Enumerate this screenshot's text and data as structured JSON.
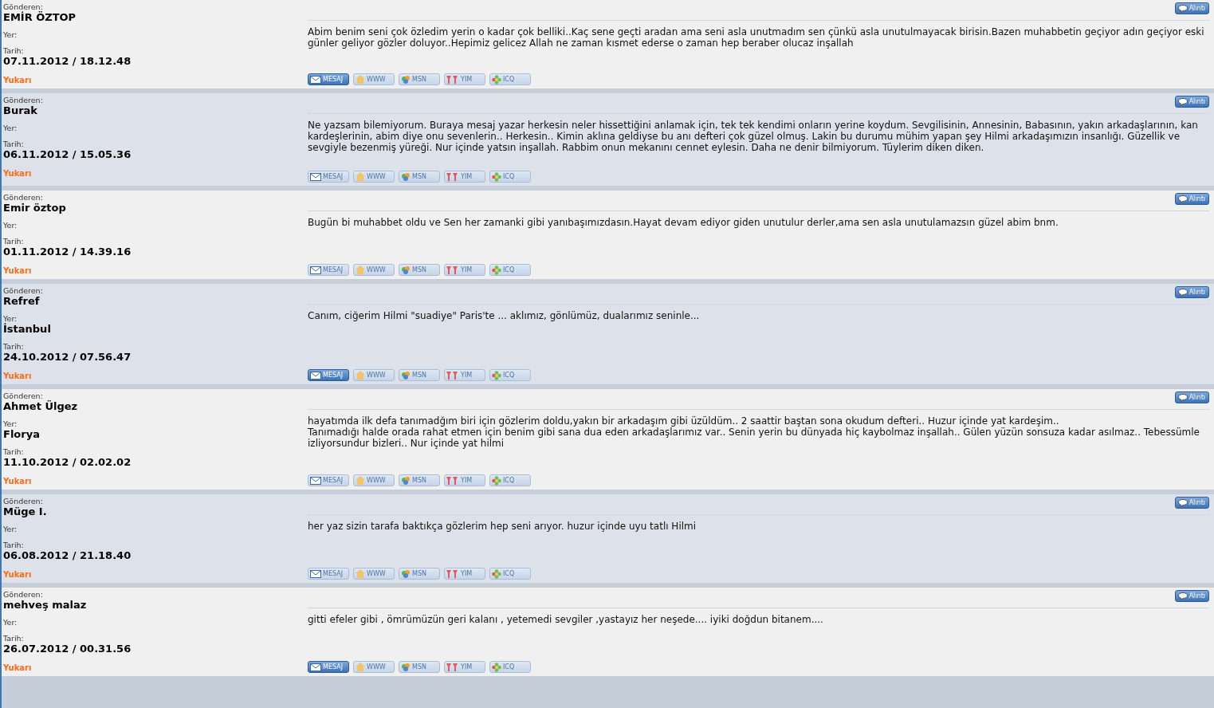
{
  "entries": [
    {
      "sender_label": "Gönderen:",
      "sender": "EMİR ÖZTOP",
      "location_label": "Yer:",
      "date_label": "Tarih:",
      "date": "07.11.2012 / 18.12.48",
      "top_link": "Yukarı",
      "quote_button": "Alıntı",
      "message": [
        "Abim benim seni çok özledim yerin o kadar çok belliki..Kaç sene geçti aradan ama seni asla unutmadım sen çünkü asla unutulmayacak birisin.Bazen muhabbetin geçiyor adın geçiyor eski günler geliyor gözler doluyor..Hepimiz gelicez Allah ne zaman kısmet ederse o zaman hep beraber olucaz inşallah"
      ],
      "buttons": [
        {
          "kind": "mail",
          "label": "MESAJ",
          "enabled": true
        },
        {
          "kind": "home",
          "label": "WWW",
          "enabled": false
        },
        {
          "kind": "msn",
          "label": "MSN",
          "enabled": false
        },
        {
          "kind": "yim",
          "label": "YIM",
          "enabled": false
        },
        {
          "kind": "icq",
          "label": "ICQ",
          "enabled": false
        }
      ]
    },
    {
      "sender_label": "Gönderen:",
      "sender": "Burak",
      "location_label": "Yer:",
      "date_label": "Tarih:",
      "date": "06.11.2012 / 15.05.36",
      "top_link": "Yukarı",
      "quote_button": "Alıntı",
      "message": [
        "Ne yazsam bilemiyorum. Buraya mesaj yazar herkesin neler hissettiğini anlamak için, tek tek kendimi onların yerine koydum. Sevgilisinin, Annesinin, Babasının, yakın arkadaşlarının, kan kardeşlerinin, abim diye onu sevenlerin.. Herkesin.. Kimin aklına geldiyse bu anı defteri çok güzel olmuş. Lakin bu durumu mühim yapan şey Hilmi arkadaşımızın insanlığı. Güzellik ve sevgiyle bezenmiş yüreği. Nur içinde yatsın inşallah. Rabbim onun mekanını cennet eylesin. Daha ne denir bilmiyorum. Tüylerim diken diken."
      ],
      "buttons": [
        {
          "kind": "mail",
          "label": "MESAJ",
          "enabled": false
        },
        {
          "kind": "home",
          "label": "WWW",
          "enabled": false
        },
        {
          "kind": "msn",
          "label": "MSN",
          "enabled": false
        },
        {
          "kind": "yim",
          "label": "YIM",
          "enabled": false
        },
        {
          "kind": "icq",
          "label": "ICQ",
          "enabled": false
        }
      ]
    },
    {
      "sender_label": "Gönderen:",
      "sender": "Emir öztop",
      "location_label": "Yer:",
      "date_label": "Tarih:",
      "date": "01.11.2012 / 14.39.16",
      "top_link": "Yukarı",
      "quote_button": "Alıntı",
      "message": [
        "Bugün bi muhabbet oldu ve Sen her zamanki gibi yanıbaşımızdasın.Hayat devam ediyor giden unutulur derler,ama sen asla unutulamazsın güzel abim bnm."
      ],
      "buttons": [
        {
          "kind": "mail",
          "label": "MESAJ",
          "enabled": false
        },
        {
          "kind": "home",
          "label": "WWW",
          "enabled": false
        },
        {
          "kind": "msn",
          "label": "MSN",
          "enabled": false
        },
        {
          "kind": "yim",
          "label": "YIM",
          "enabled": false
        },
        {
          "kind": "icq",
          "label": "ICQ",
          "enabled": false
        }
      ]
    },
    {
      "sender_label": "Gönderen:",
      "sender": "Refref",
      "location_label": "Yer:",
      "location": "İstanbul",
      "date_label": "Tarih:",
      "date": "24.10.2012 / 07.56.47",
      "top_link": "Yukarı",
      "quote_button": "Alıntı",
      "message": [
        "Canım, ciğerim Hilmi \"suadiye\" Paris'te ... aklımız, gönlümüz, dualarımız seninle..."
      ],
      "buttons": [
        {
          "kind": "mail",
          "label": "MESAJ",
          "enabled": true
        },
        {
          "kind": "home",
          "label": "WWW",
          "enabled": false
        },
        {
          "kind": "msn",
          "label": "MSN",
          "enabled": false
        },
        {
          "kind": "yim",
          "label": "YIM",
          "enabled": false
        },
        {
          "kind": "icq",
          "label": "ICQ",
          "enabled": false
        }
      ]
    },
    {
      "sender_label": "Gönderen:",
      "sender": "Ahmet Ülgez",
      "location_label": "Yer:",
      "location": "Florya",
      "date_label": "Tarih:",
      "date": "11.10.2012 / 02.02.02",
      "top_link": "Yukarı",
      "quote_button": "Alıntı",
      "message": [
        "hayatımda ilk defa tanımadğım biri için gözlerim doldu,yakın bir arkadaşım gibi üzüldüm.. 2 saattir baştan sona okudum defteri.. Huzur içinde yat kardeşim..",
        "Tanımadığı halde orada rahat etmen için benim gibi sana dua eden arkadaşlarımız var.. Senin yerin bu dünyada hiç kaybolmaz inşallah.. Gülen yüzün sonsuza kadar asılmaz.. Tebessümle izliyorsundur bizleri.. Nur içinde yat hilmi"
      ],
      "buttons": [
        {
          "kind": "mail",
          "label": "MESAJ",
          "enabled": false
        },
        {
          "kind": "home",
          "label": "WWW",
          "enabled": false
        },
        {
          "kind": "msn",
          "label": "MSN",
          "enabled": false
        },
        {
          "kind": "yim",
          "label": "YIM",
          "enabled": false
        },
        {
          "kind": "icq",
          "label": "ICQ",
          "enabled": false
        }
      ]
    },
    {
      "sender_label": "Gönderen:",
      "sender": "Müge I.",
      "location_label": "Yer:",
      "date_label": "Tarih:",
      "date": "06.08.2012 / 21.18.40",
      "top_link": "Yukarı",
      "quote_button": "Alıntı",
      "message": [
        "her yaz sizin tarafa baktıkça gözlerim hep seni arıyor. huzur içinde uyu tatlı Hilmi"
      ],
      "buttons": [
        {
          "kind": "mail",
          "label": "MESAJ",
          "enabled": false
        },
        {
          "kind": "home",
          "label": "WWW",
          "enabled": false
        },
        {
          "kind": "msn",
          "label": "MSN",
          "enabled": false
        },
        {
          "kind": "yim",
          "label": "YIM",
          "enabled": false
        },
        {
          "kind": "icq",
          "label": "ICQ",
          "enabled": false
        }
      ]
    },
    {
      "sender_label": "Gönderen:",
      "sender": "mehveş malaz",
      "location_label": "Yer:",
      "date_label": "Tarih:",
      "date": "26.07.2012 / 00.31.56",
      "top_link": "Yukarı",
      "quote_button": "Alıntı",
      "message": [
        "gitti efeler gibi , ömrümüzün geri kalanı , yetemedi sevgiler ,yastayız her neşede.... iyiki doğdun bitanem...."
      ],
      "buttons": [
        {
          "kind": "mail",
          "label": "MESAJ",
          "enabled": true
        },
        {
          "kind": "home",
          "label": "WWW",
          "enabled": false
        },
        {
          "kind": "msn",
          "label": "MSN",
          "enabled": false
        },
        {
          "kind": "yim",
          "label": "YIM",
          "enabled": false
        },
        {
          "kind": "icq",
          "label": "ICQ",
          "enabled": false
        }
      ]
    }
  ]
}
